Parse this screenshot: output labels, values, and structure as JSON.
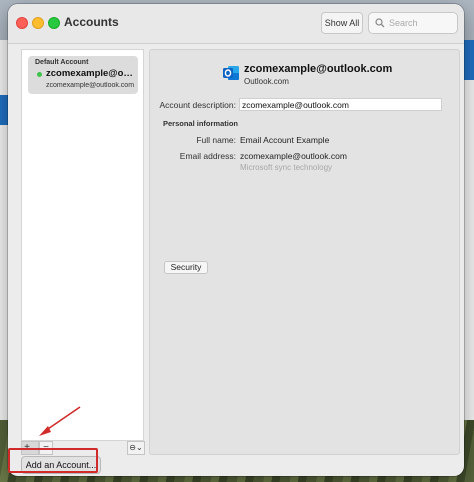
{
  "window": {
    "title": "Accounts"
  },
  "toolbar": {
    "show_all_label": "Show All",
    "search_placeholder": "Search"
  },
  "sidebar": {
    "accounts": [
      {
        "header": "Default Account",
        "name": "zcomexample@outlook.com",
        "email": "zcomexample@outlook.com",
        "status": "active"
      }
    ],
    "add_symbol": "+",
    "add_chevron": "⌄",
    "remove_symbol": "−",
    "more_symbol": "⊖⌄",
    "add_account_label": "Add an Account..."
  },
  "detail": {
    "email": "zcomexample@outlook.com",
    "provider": "Outlook.com",
    "account_description_label": "Account description:",
    "account_description_value": "zcomexample@outlook.com",
    "personal_info_title": "Personal information",
    "full_name_label": "Full name:",
    "full_name_value": "Email Account Example",
    "email_address_label": "Email address:",
    "email_address_value": "zcomexample@outlook.com",
    "sync_note": "Microsoft sync technology",
    "security_label": "Security"
  },
  "colors": {
    "highlight": "#d02a2a",
    "status_active": "#3ec24a",
    "outlook_blue": "#0f64c4"
  }
}
